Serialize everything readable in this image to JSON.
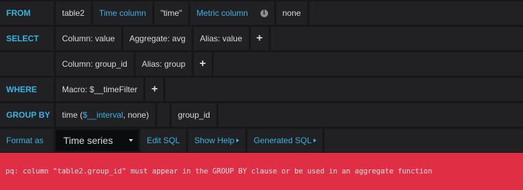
{
  "from": {
    "keyword": "FROM",
    "table": "table2",
    "time_column_label": "Time column",
    "time_column_value": "\"time\"",
    "metric_column_label": "Metric column",
    "info_icon": "i",
    "metric_column_value": "none"
  },
  "select": {
    "keyword": "SELECT",
    "rows": [
      {
        "column": "Column: value",
        "aggregate": "Aggregate: avg",
        "alias": "Alias: value",
        "add": "+"
      },
      {
        "column": "Column: group_id",
        "alias": "Alias: group",
        "add": "+"
      }
    ]
  },
  "where": {
    "keyword": "WHERE",
    "macro": "Macro: $__timeFilter",
    "add": "+"
  },
  "group_by": {
    "keyword": "GROUP BY",
    "time_prefix": "time (",
    "time_macro": "$__interval",
    "time_suffix": ", none)",
    "column": "group_id"
  },
  "format": {
    "keyword": "Format as",
    "selected": "Time series",
    "edit_sql": "Edit SQL",
    "show_help": "Show Help",
    "generated_sql": "Generated SQL"
  },
  "error": {
    "message": "pq: column \"table2.group_id\" must appear in the GROUP BY clause or be used in an aggregate function"
  },
  "colors": {
    "background": "#161719",
    "cell": "#212124",
    "accent": "#33b5e5",
    "error": "#e02f44"
  }
}
